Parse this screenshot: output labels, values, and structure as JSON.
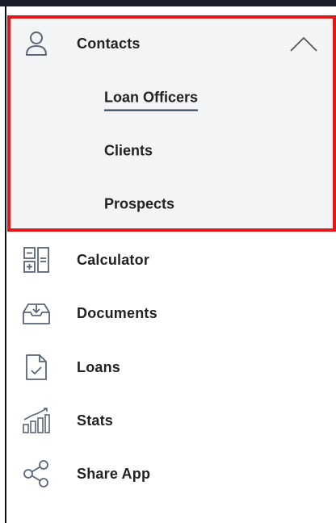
{
  "menu": {
    "contacts": {
      "label": "Contacts",
      "icon": "person-icon",
      "expanded": true,
      "submenu": [
        {
          "label": "Loan Officers",
          "active": true
        },
        {
          "label": "Clients",
          "active": false
        },
        {
          "label": "Prospects",
          "active": false
        }
      ]
    },
    "items": [
      {
        "label": "Calculator",
        "icon": "calculator-icon"
      },
      {
        "label": "Documents",
        "icon": "document-tray-icon"
      },
      {
        "label": "Loans",
        "icon": "document-check-icon"
      },
      {
        "label": "Stats",
        "icon": "stats-icon"
      },
      {
        "label": "Share App",
        "icon": "share-icon"
      }
    ]
  },
  "colors": {
    "highlight": "#e01818",
    "panel_bg": "#f3f4f6",
    "text": "#222222",
    "icon_stroke": "#5b6575",
    "active_underline": "#2a3d52"
  }
}
